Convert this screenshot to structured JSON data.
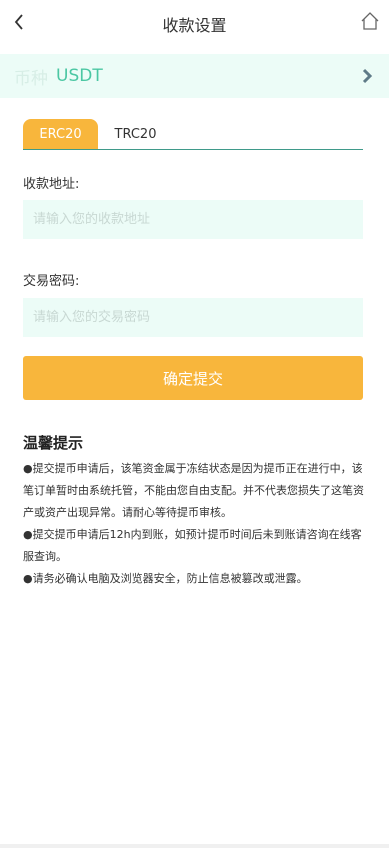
{
  "header": {
    "title": "收款设置",
    "back_icon": "chevron-left-icon",
    "home_icon": "home-icon"
  },
  "coin": {
    "label": "币种",
    "value": "USDT",
    "arrow_icon": "chevron-right-icon"
  },
  "tabs": [
    {
      "label": "ERC20",
      "active": true
    },
    {
      "label": "TRC20",
      "active": false
    }
  ],
  "form": {
    "address_label": "收款地址:",
    "address_placeholder": "请输入您的收款地址",
    "address_value": "",
    "password_label": "交易密码:",
    "password_placeholder": "请输入您的交易密码",
    "password_value": ""
  },
  "submit_label": "确定提交",
  "tips": {
    "title": "温馨提示",
    "items": [
      "●提交提币申请后，该笔资金属于冻结状态是因为提币正在进行中，该笔订单暂时由系统托管，不能由您自由支配。并不代表您损失了这笔资产或资产出现异常。请耐心等待提币审核。",
      "●提交提币申请后12h内到账，如预计提币时间后未到账请咨询在线客服查询。",
      "●请务必确认电脑及浏览器安全，防止信息被篡改或泄露。"
    ]
  },
  "colors": {
    "accent": "#f8b63c",
    "mint_bg": "#ecfcf7",
    "teal_text": "#4bc7a3",
    "tab_underline": "#3f9a8a"
  }
}
